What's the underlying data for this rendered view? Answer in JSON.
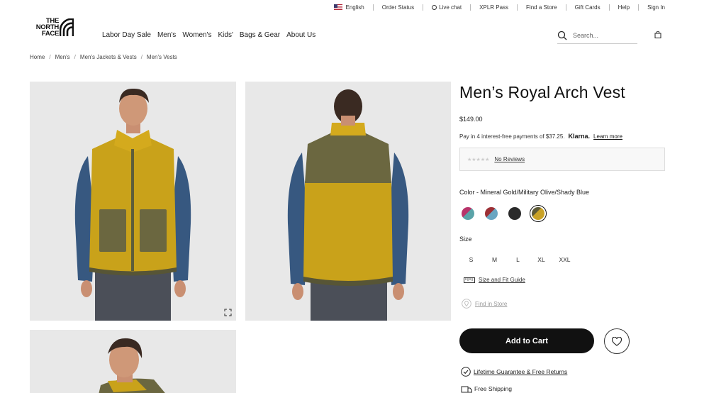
{
  "utility": {
    "language": "English",
    "order_status": "Order Status",
    "live_chat": "Live chat",
    "xplr_pass": "XPLR Pass",
    "find_store": "Find a Store",
    "gift_cards": "Gift Cards",
    "help": "Help",
    "sign_in": "Sign In"
  },
  "logo": {
    "line1": "THE",
    "line2": "NORTH",
    "line3": "FACE"
  },
  "nav": [
    "Labor Day Sale",
    "Men's",
    "Women's",
    "Kids'",
    "Bags & Gear",
    "About Us"
  ],
  "search": {
    "placeholder": "Search..."
  },
  "breadcrumb": [
    "Home",
    "Men's",
    "Men's Jackets & Vests",
    "Men's Vests"
  ],
  "product": {
    "title": "Men’s Royal Arch Vest",
    "price": "$149.00",
    "klarna_text": "Pay in 4 interest-free payments of $37.25.",
    "klarna_brand": "Klarna.",
    "klarna_link": "Learn more",
    "stars": "★★★★★",
    "reviews": "No Reviews",
    "color_label": "Color - Mineral Gold/Military Olive/Shady Blue",
    "swatches": [
      {
        "name": "pink-teal",
        "color": "#b8346a",
        "color2": "#5aa3a8"
      },
      {
        "name": "red-blue",
        "color": "#9c2f35",
        "color2": "#6aa6c2"
      },
      {
        "name": "black",
        "color": "#2a2a2a",
        "color2": "#2a2a2a"
      },
      {
        "name": "mineral-gold",
        "color": "#c9a227",
        "color2": "#5d5a36"
      }
    ],
    "size_label": "Size",
    "sizes": [
      "S",
      "M",
      "L",
      "XL",
      "XXL"
    ],
    "fit_guide": "Size and Fit Guide",
    "find_in_store": "Find in Store",
    "add_to_cart": "Add to Cart",
    "guarantee": "Lifetime Guarantee & Free Returns",
    "shipping": "Free Shipping"
  }
}
